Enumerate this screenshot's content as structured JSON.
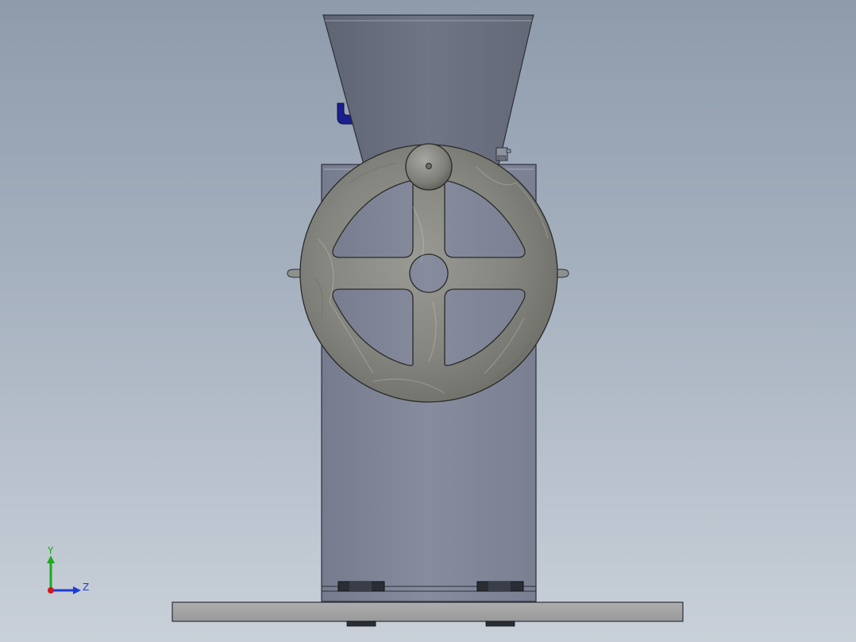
{
  "viewport": {
    "background_top": "#8e9bab",
    "background_bottom": "#c9d0d9"
  },
  "model": {
    "body_color": "#7f8597",
    "hopper_color": "#6b7080",
    "wheel_color": "#8a8b86",
    "base_color": "#a3a3a3",
    "lever_color": "#1a1f8c"
  },
  "triad": {
    "y_label": "Y",
    "z_label": "Z",
    "y_color": "#1faa1f",
    "z_color": "#1f3cd6",
    "origin_color": "#d01818"
  }
}
